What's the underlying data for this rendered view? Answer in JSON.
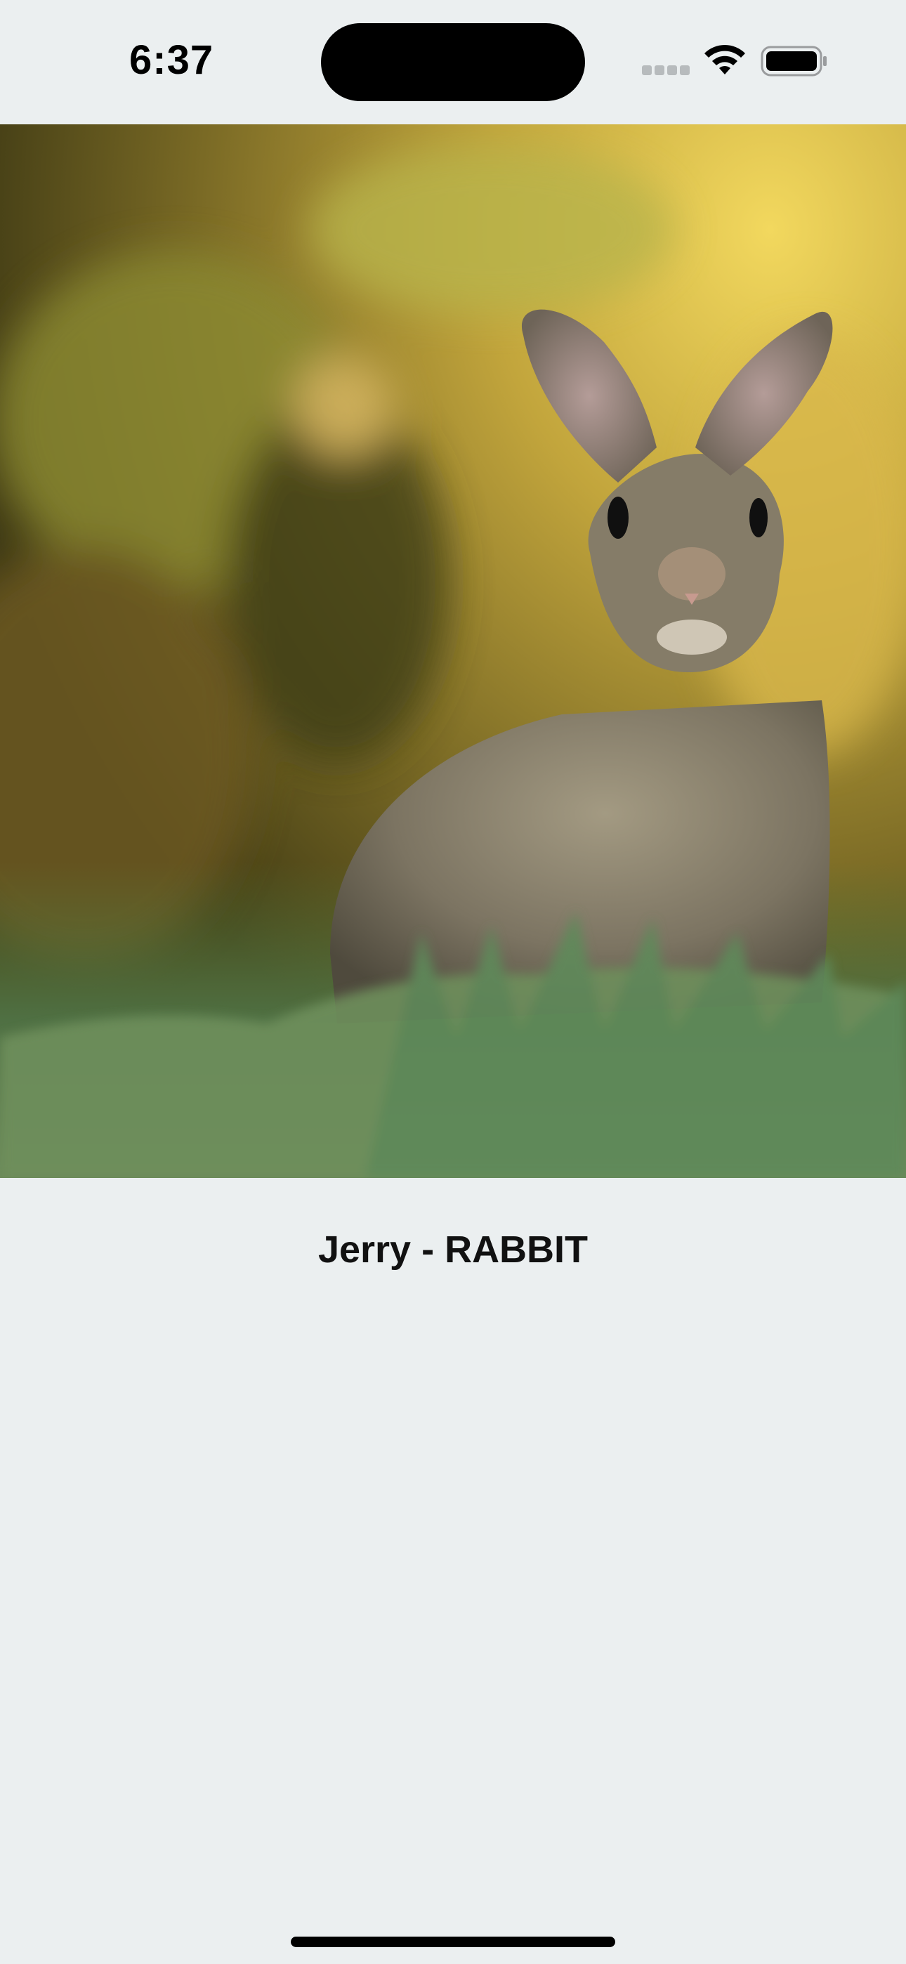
{
  "status_bar": {
    "time": "6:37",
    "icons": [
      "cellular-signal-icon",
      "wifi-icon",
      "battery-icon"
    ]
  },
  "hero_image": {
    "subject": "rabbit-photo"
  },
  "pet": {
    "title": "Jerry - RABBIT"
  },
  "colors": {
    "background": "#ebeff0",
    "text": "#111111"
  }
}
